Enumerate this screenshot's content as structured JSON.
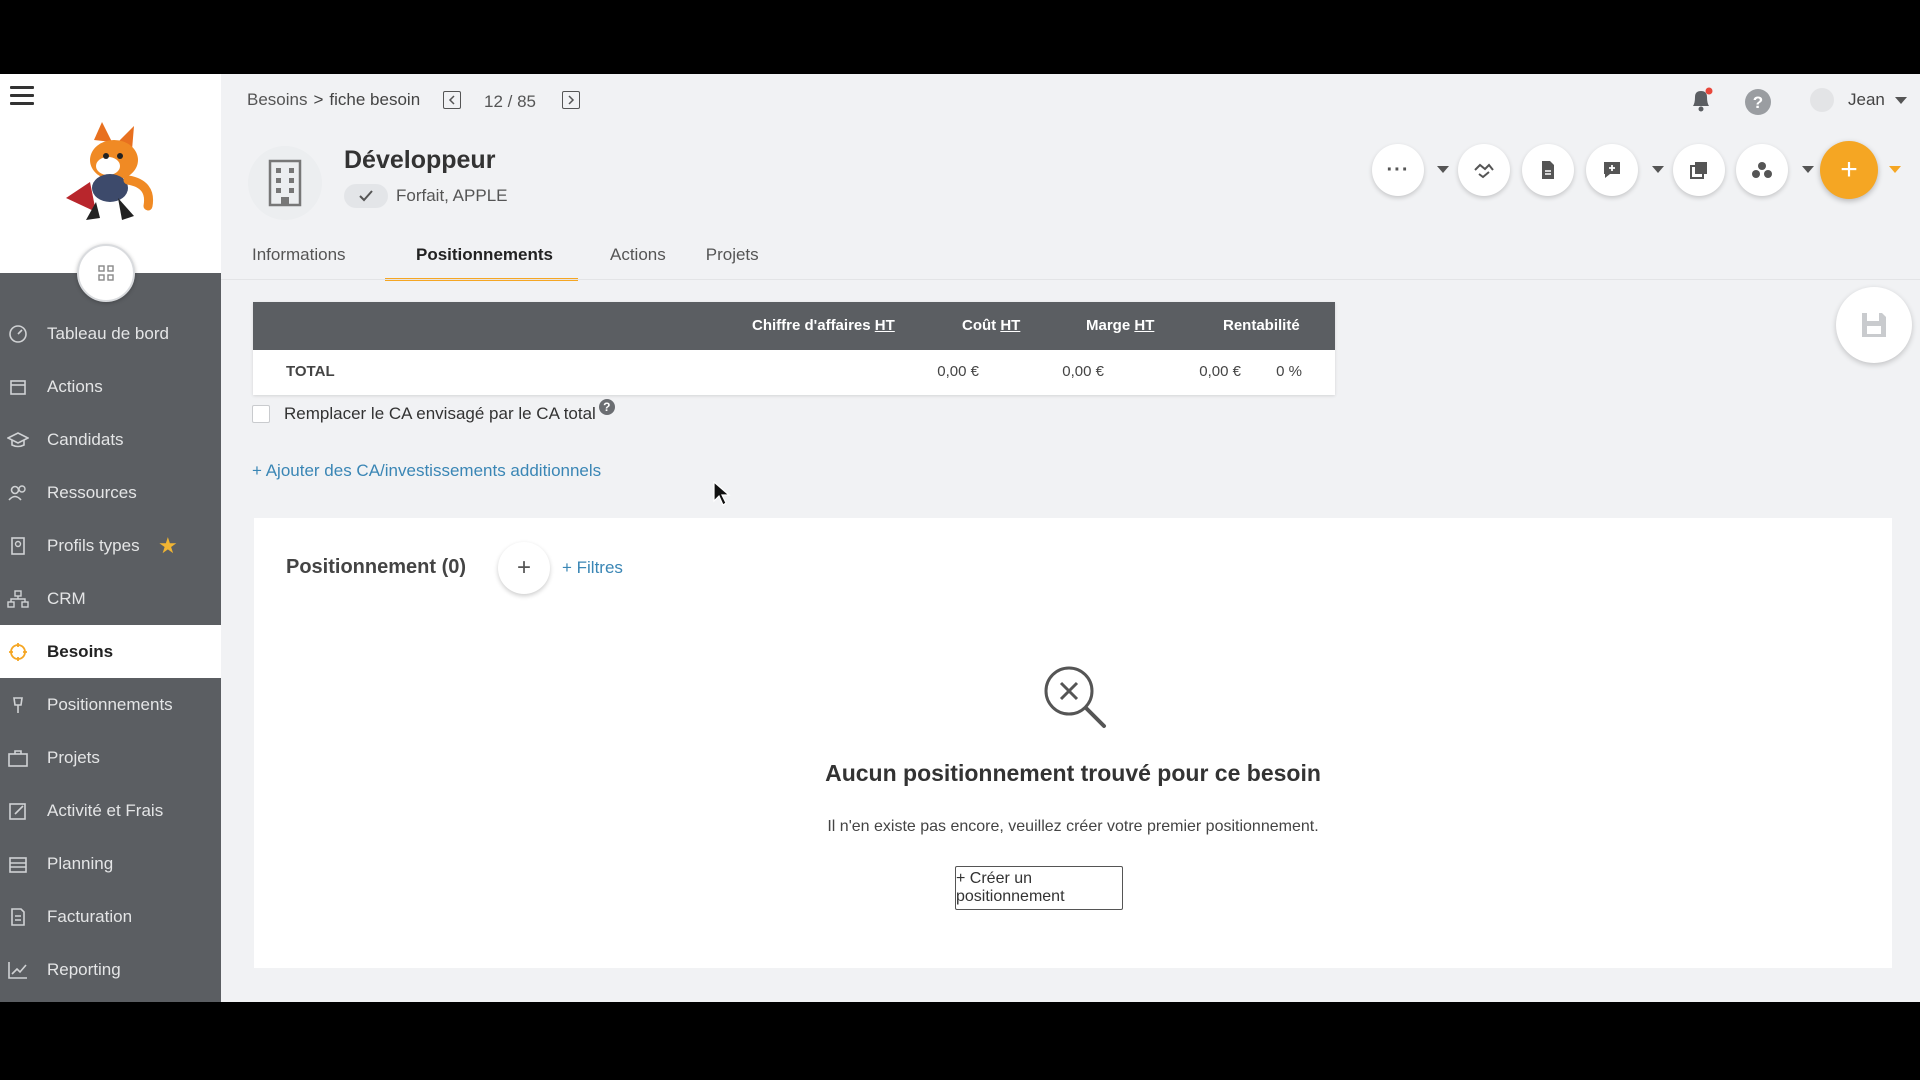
{
  "breadcrumb": {
    "parent": "Besoins",
    "separator": ">",
    "current": "fiche besoin"
  },
  "pager": {
    "text": "12 / 85"
  },
  "user": {
    "name": "Jean"
  },
  "entity": {
    "title": "Développeur",
    "subtitle": "Forfait, APPLE"
  },
  "sidebar": {
    "items": [
      {
        "label": "Tableau de bord",
        "icon": "dashboard-icon"
      },
      {
        "label": "Actions",
        "icon": "calendar-icon"
      },
      {
        "label": "Candidats",
        "icon": "graduation-icon"
      },
      {
        "label": "Ressources",
        "icon": "people-icon"
      },
      {
        "label": "Profils types",
        "icon": "profile-icon"
      },
      {
        "label": "CRM",
        "icon": "org-icon"
      },
      {
        "label": "Besoins",
        "icon": "target-icon"
      },
      {
        "label": "Positionnements",
        "icon": "pin-icon"
      },
      {
        "label": "Projets",
        "icon": "briefcase-icon"
      },
      {
        "label": "Activité et Frais",
        "icon": "edit-icon"
      },
      {
        "label": "Planning",
        "icon": "planning-icon"
      },
      {
        "label": "Facturation",
        "icon": "invoice-icon"
      },
      {
        "label": "Reporting",
        "icon": "chart-icon"
      }
    ]
  },
  "tabs": [
    "Informations",
    "Positionnements",
    "Actions",
    "Projets"
  ],
  "totals": {
    "headers": {
      "ca": "Chiffre d'affaires",
      "cout": "Coût",
      "marge": "Marge",
      "ht": "HT",
      "rentabilite": "Rentabilité"
    },
    "row": {
      "label": "TOTAL",
      "ca": "0,00 €",
      "cout": "0,00 €",
      "marge": "0,00 €",
      "rentabilite": "0 %"
    }
  },
  "checkbox": {
    "label": "Remplacer le CA envisagé par le CA total",
    "help": "?"
  },
  "add_link": "+ Ajouter des CA/investissements additionnels",
  "positionnement": {
    "title": "Positionnement (0)",
    "add": "+",
    "filters": "+ Filtres",
    "empty_title": "Aucun positionnement trouvé pour ce besoin",
    "empty_text": "Il n'en existe pas encore, veuillez créer votre premier positionnement.",
    "create_label": "+ Créer un positionnement"
  },
  "colors": {
    "accent": "#f5a623",
    "sidebar": "#5b5e62",
    "link": "#3a86b5"
  }
}
